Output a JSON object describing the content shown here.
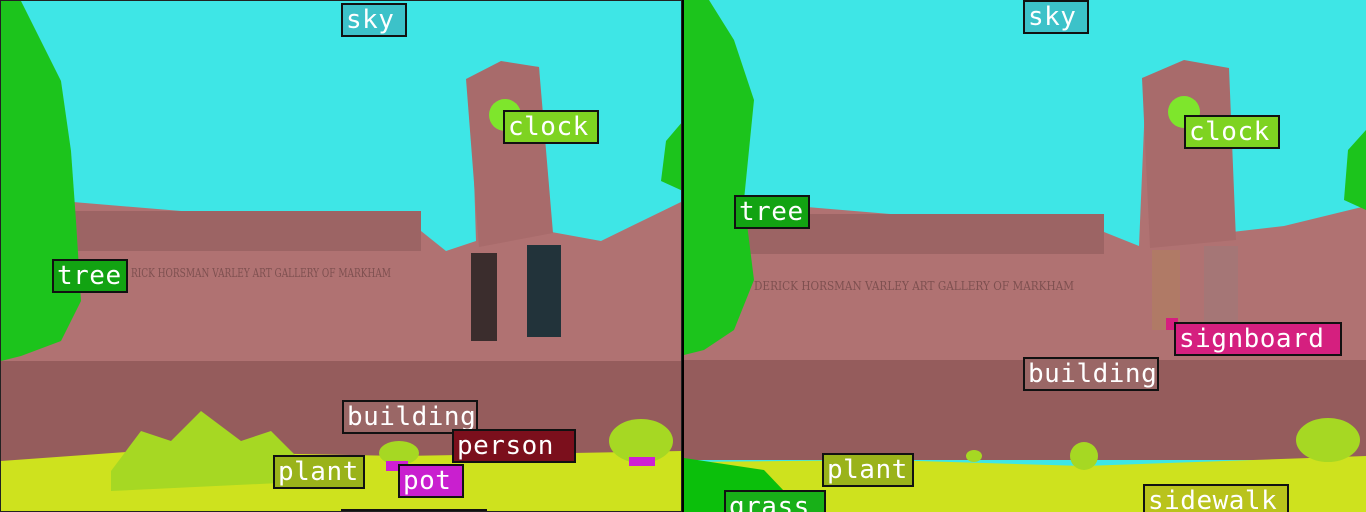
{
  "colors": {
    "sky": "#3ee6e6",
    "building": "#b07272",
    "building_dark": "#955c5c",
    "tree": "#1cc41c",
    "plant": "#a6d823",
    "grass": "#0bbf0b",
    "sidewalk": "#cee21e",
    "clock": "#7ee62c",
    "pot": "#cf1fd4",
    "person": "#7b0f1c",
    "signboard": "#d51f7f"
  },
  "left_panel": {
    "facade_text": "RICK HORSMAN VARLEY ART GALLERY OF MARKHAM",
    "labels": {
      "sky": "sky",
      "clock": "clock",
      "tree": "tree",
      "building": "building",
      "person": "person",
      "plant": "plant",
      "pot": "pot"
    }
  },
  "right_panel": {
    "facade_text": "DERICK HORSMAN VARLEY ART GALLERY OF MARKHAM",
    "labels": {
      "sky": "sky",
      "clock": "clock",
      "tree": "tree",
      "signboard": "signboard",
      "building": "building",
      "plant": "plant",
      "grass": "grass",
      "sidewalk": "sidewalk"
    }
  }
}
